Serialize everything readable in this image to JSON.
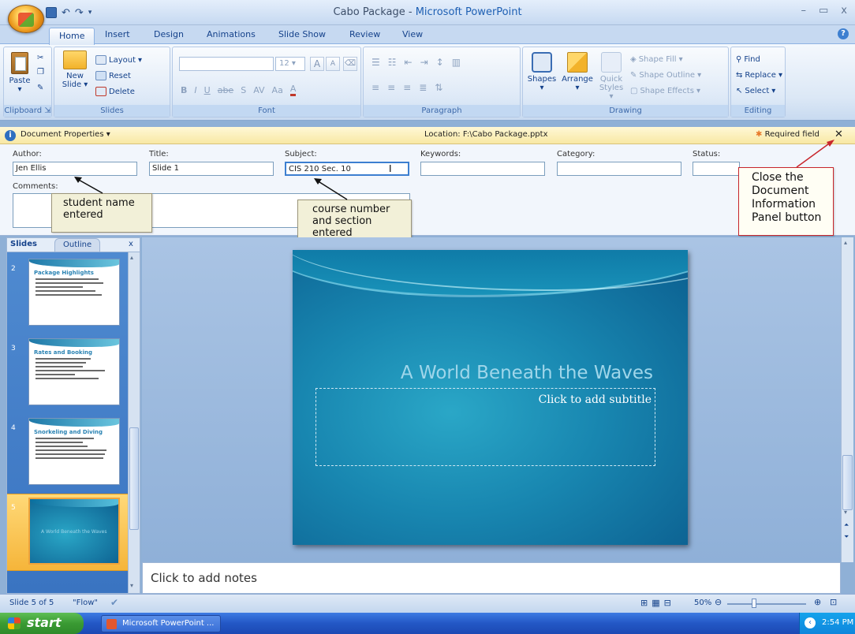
{
  "window": {
    "title_doc": "Cabo Package",
    "title_sep": " - ",
    "title_app": "Microsoft PowerPoint",
    "min": "–",
    "max": "▭",
    "close": "x"
  },
  "tabs": [
    "Home",
    "Insert",
    "Design",
    "Animations",
    "Slide Show",
    "Review",
    "View"
  ],
  "help": "?",
  "ribbon": {
    "clipboard": {
      "paste": "Paste",
      "label": "Clipboard"
    },
    "slides": {
      "new_slide_1": "New",
      "new_slide_2": "Slide",
      "layout": "Layout",
      "reset": "Reset",
      "delete": "Delete",
      "label": "Slides"
    },
    "font": {
      "size": "12",
      "bold": "B",
      "italic": "I",
      "underline": "U",
      "strike": "abe",
      "shadow": "S",
      "spacing": "AV",
      "case": "Aa",
      "color": "A",
      "grow": "A",
      "shrink": "A",
      "label": "Font"
    },
    "paragraph": {
      "label": "Paragraph"
    },
    "drawing": {
      "shapes": "Shapes",
      "arrange": "Arrange",
      "quick_styles_1": "Quick",
      "quick_styles_2": "Styles",
      "fill": "Shape Fill",
      "outline": "Shape Outline",
      "effects": "Shape Effects",
      "label": "Drawing"
    },
    "editing": {
      "find": "Find",
      "replace": "Replace",
      "select": "Select",
      "label": "Editing"
    }
  },
  "doc_properties": {
    "header": "Document Properties",
    "location_label": "Location:",
    "location": "F:\\Cabo Package.pptx",
    "required": "Required field",
    "close": "✕",
    "author_label": "Author:",
    "author": "Jen Ellis",
    "title_label": "Title:",
    "title": "Slide 1",
    "subject_label": "Subject:",
    "subject": "CIS 210 Sec. 10",
    "keywords_label": "Keywords:",
    "category_label": "Category:",
    "status_label": "Status:",
    "comments_label": "Comments:"
  },
  "callouts": {
    "student": [
      "student name",
      "entered"
    ],
    "course": [
      "course number",
      "and section",
      "entered"
    ],
    "close": [
      "Close the",
      "Document",
      "Information",
      "Panel button"
    ]
  },
  "slides_pane": {
    "tab_slides": "Slides",
    "tab_outline": "Outline",
    "close": "x",
    "thumbs": [
      {
        "num": "2",
        "title": "Package Highlights"
      },
      {
        "num": "3",
        "title": "Rates and Booking"
      },
      {
        "num": "4",
        "title": "Snorkeling and Diving"
      },
      {
        "num": "5",
        "title": "A World Beneath the Waves"
      }
    ]
  },
  "slide": {
    "title": "A World Beneath the Waves",
    "subtitle_placeholder": "Click to add subtitle"
  },
  "notes": "Click to add notes",
  "status_bar": {
    "slide_of": "Slide 5 of 5",
    "theme": "\"Flow\"",
    "zoom": "50%"
  },
  "taskbar": {
    "start": "start",
    "app": "Microsoft PowerPoint ...",
    "time": "2:54 PM"
  },
  "colors": {
    "accent": "#1d5fb3",
    "callout_border": "#c8262c",
    "doc_bar": "#f8e8a4"
  }
}
